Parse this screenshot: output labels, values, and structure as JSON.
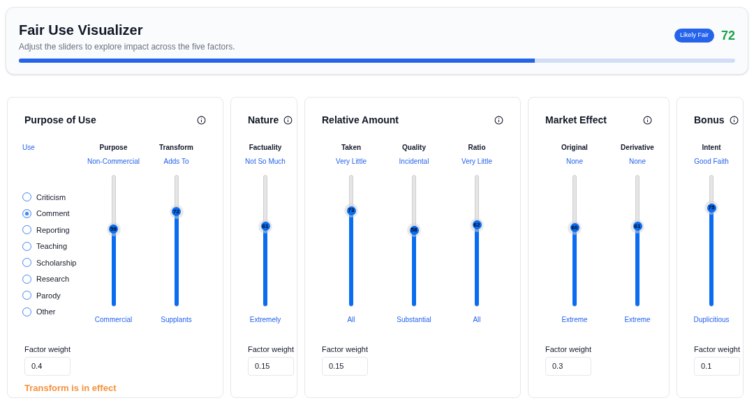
{
  "header": {
    "title": "Fair Use Visualizer",
    "subtitle": "Adjust the sliders to explore impact across the five factors.",
    "badge": "Likely Fair",
    "score": "72",
    "level": 0.72
  },
  "factors": [
    {
      "title": "Purpose of Use",
      "use": {
        "label": "Use",
        "options": [
          {
            "label": "Criticism",
            "selected": false
          },
          {
            "label": "Comment",
            "selected": true
          },
          {
            "label": "Reporting",
            "selected": false
          },
          {
            "label": "Teaching",
            "selected": false
          },
          {
            "label": "Scholarship",
            "selected": false
          },
          {
            "label": "Research",
            "selected": false
          },
          {
            "label": "Parody",
            "selected": false
          },
          {
            "label": "Other",
            "selected": false
          }
        ]
      },
      "sliders": [
        {
          "label": "Purpose",
          "top": "Non-Commercial",
          "bottom": "Commercial",
          "value": "59",
          "level": 0.59
        },
        {
          "label": "Transform",
          "top": "Adds To",
          "bottom": "Supplants",
          "value": "72",
          "level": 0.72
        }
      ],
      "weight_label": "Factor weight",
      "weight": "0.4",
      "message": "Transform is in effect"
    },
    {
      "title": "Nature",
      "sliders": [
        {
          "label": "Factuality",
          "top": "Not So Much",
          "bottom": "Extremely",
          "value": "61",
          "level": 0.61
        }
      ],
      "weight_label": "Factor weight",
      "weight": "0.15"
    },
    {
      "title": "Relative Amount",
      "sliders": [
        {
          "label": "Taken",
          "top": "Very Little",
          "bottom": "All",
          "value": "73",
          "level": 0.73
        },
        {
          "label": "Quality",
          "top": "Incidental",
          "bottom": "Substantial",
          "value": "58",
          "level": 0.58
        },
        {
          "label": "Ratio",
          "top": "Very Little",
          "bottom": "All",
          "value": "62",
          "level": 0.62
        }
      ],
      "weight_label": "Factor weight",
      "weight": "0.15"
    },
    {
      "title": "Market Effect",
      "sliders": [
        {
          "label": "Original",
          "top": "None",
          "bottom": "Extreme",
          "value": "60",
          "level": 0.6
        },
        {
          "label": "Derivative",
          "top": "None",
          "bottom": "Extreme",
          "value": "61",
          "level": 0.61
        }
      ],
      "weight_label": "Factor weight",
      "weight": "0.3"
    },
    {
      "title": "Bonus",
      "sliders": [
        {
          "label": "Intent",
          "top": "Good Faith",
          "bottom": "Duplicitious",
          "value": "75",
          "level": 0.75
        }
      ],
      "weight_label": "Factor weight",
      "weight": "0.1"
    }
  ]
}
